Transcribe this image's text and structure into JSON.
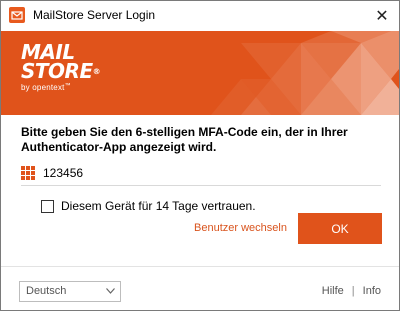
{
  "window": {
    "title": "MailStore Server Login",
    "close_glyph": "✕"
  },
  "banner": {
    "logo_line1": "MAIL",
    "logo_line2": "STORE",
    "logo_registered": "®",
    "logo_sub": "by opentext",
    "logo_tm": "™",
    "accent_color": "#e0531b"
  },
  "main": {
    "prompt": "Bitte geben Sie den 6-stelligen MFA-Code ein, der in Ihrer Authenticator-App angezeigt wird.",
    "code_value": "123456",
    "code_icon": "keypad-icon",
    "trust_label": "Diesem Gerät für 14 Tage vertrauen.",
    "trust_checked": false,
    "switch_user_label": "Benutzer wechseln",
    "ok_label": "OK"
  },
  "footer": {
    "language": "Deutsch",
    "help_label": "Hilfe",
    "separator": "|",
    "info_label": "Info"
  }
}
